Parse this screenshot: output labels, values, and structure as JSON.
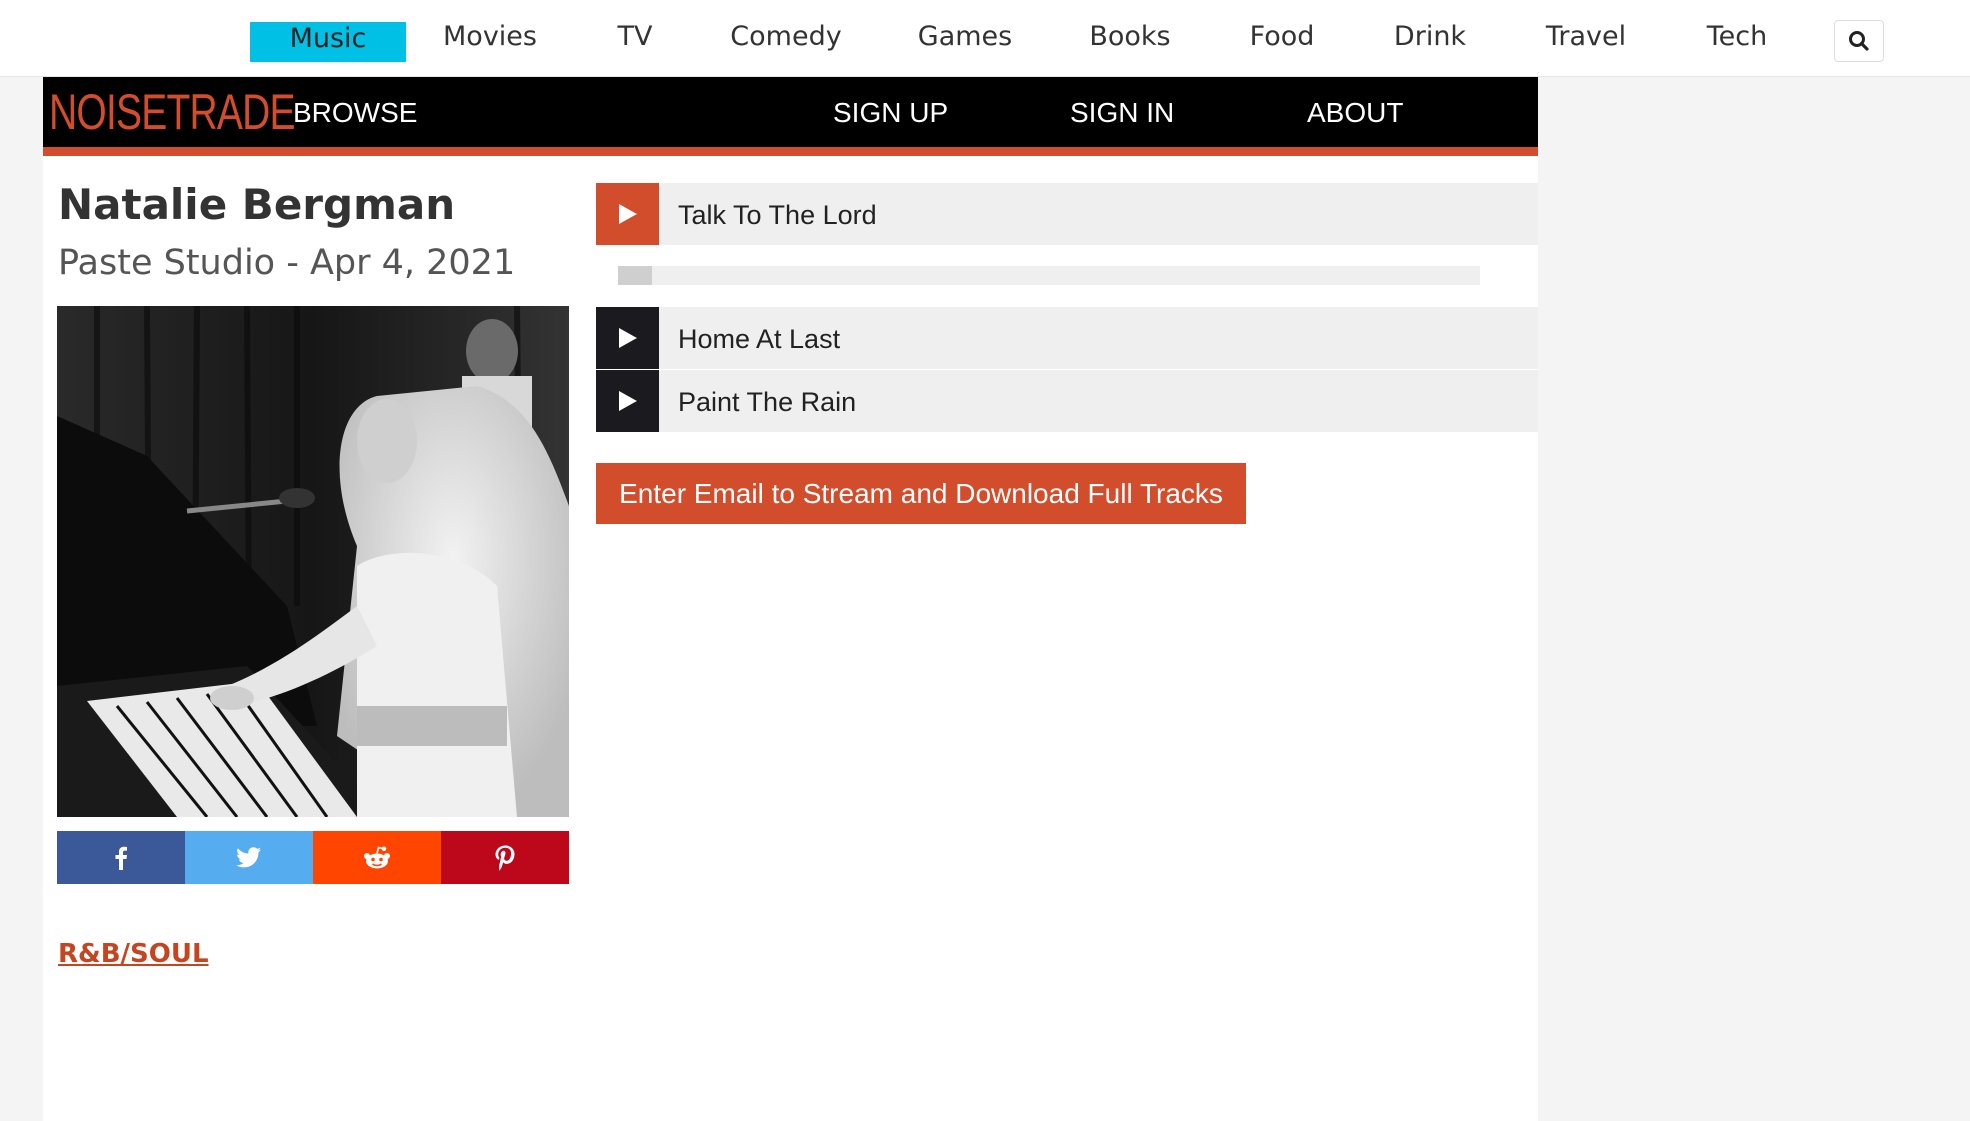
{
  "topnav": {
    "categories": [
      "Music",
      "Movies",
      "TV",
      "Comedy",
      "Games",
      "Books",
      "Food",
      "Drink",
      "Travel",
      "Tech"
    ],
    "active": "Music",
    "active_color": "#00c0e6"
  },
  "header": {
    "logo": "NOISETRADE",
    "browse": "BROWSE",
    "sign_up": "SIGN UP",
    "sign_in": "SIGN IN",
    "about": "ABOUT",
    "brand_color": "#d24d2c"
  },
  "session": {
    "artist": "Natalie Bergman",
    "subtitle": "Paste Studio - Apr 4, 2021",
    "genre": "R&B/SOUL"
  },
  "share": {
    "icons": [
      "facebook-icon",
      "twitter-icon",
      "reddit-icon",
      "pinterest-icon"
    ],
    "colors": [
      "#3b5998",
      "#55acee",
      "#ff4500",
      "#bd081c"
    ]
  },
  "tracks": [
    {
      "title": "Talk To The Lord",
      "active": true
    },
    {
      "title": "Home At Last",
      "active": false
    },
    {
      "title": "Paint The Rain",
      "active": false
    }
  ],
  "player": {
    "progress": 0.04
  },
  "cta": "Enter Email to Stream and Download Full Tracks"
}
